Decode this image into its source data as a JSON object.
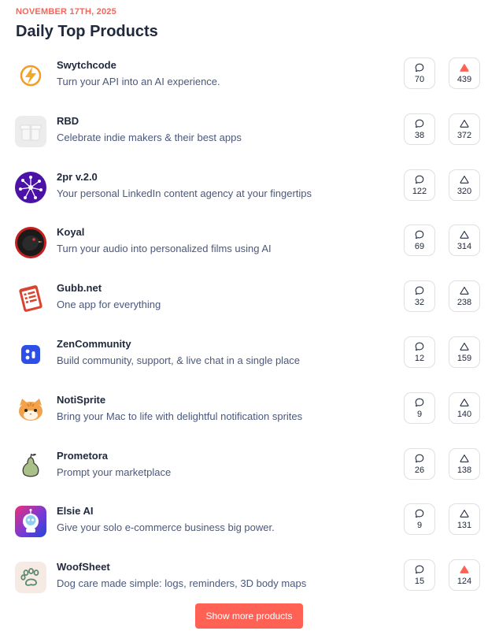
{
  "header": {
    "date": "NOVEMBER 17TH, 2025",
    "title": "Daily Top Products"
  },
  "colors": {
    "accent": "#ff6154",
    "text": "#21293c",
    "muted": "#4b587c",
    "border": "#e0e0e0"
  },
  "products": [
    {
      "name": "Swytchcode",
      "tagline": "Turn your API into an AI experience.",
      "comments": "70",
      "votes": "439",
      "voted": true,
      "icon": "lightning-bolt-logo-icon"
    },
    {
      "name": "RBD",
      "tagline": "Celebrate indie makers & their best apps",
      "comments": "38",
      "votes": "372",
      "voted": false,
      "icon": "gift-box-logo-icon"
    },
    {
      "name": "2pr v.2.0",
      "tagline": "Your personal LinkedIn content agency at your fingertips",
      "comments": "122",
      "votes": "320",
      "voted": false,
      "icon": "network-burst-logo-icon"
    },
    {
      "name": "Koyal",
      "tagline": "Turn your audio into personalized films using AI",
      "comments": "69",
      "votes": "314",
      "voted": false,
      "icon": "bird-logo-icon"
    },
    {
      "name": "Gubb.net",
      "tagline": "One app for everything",
      "comments": "32",
      "votes": "238",
      "voted": false,
      "icon": "notepad-logo-icon"
    },
    {
      "name": "ZenCommunity",
      "tagline": "Build community, support, & live chat in a single place",
      "comments": "12",
      "votes": "159",
      "voted": false,
      "icon": "dots-logo-icon"
    },
    {
      "name": "NotiSprite",
      "tagline": "Bring your Mac to life with delightful notification sprites",
      "comments": "9",
      "votes": "140",
      "voted": false,
      "icon": "cat-logo-icon"
    },
    {
      "name": "Prometora",
      "tagline": "Prompt your marketplace",
      "comments": "26",
      "votes": "138",
      "voted": false,
      "icon": "pear-logo-icon"
    },
    {
      "name": "Elsie AI",
      "tagline": "Give your solo e-commerce business big power.",
      "comments": "9",
      "votes": "131",
      "voted": false,
      "icon": "robot-logo-icon"
    },
    {
      "name": "WoofSheet",
      "tagline": "Dog care made simple: logs, reminders, 3D body maps",
      "comments": "15",
      "votes": "124",
      "voted": true,
      "icon": "paw-logo-icon"
    }
  ],
  "footer": {
    "show_more_label": "Show more products"
  }
}
